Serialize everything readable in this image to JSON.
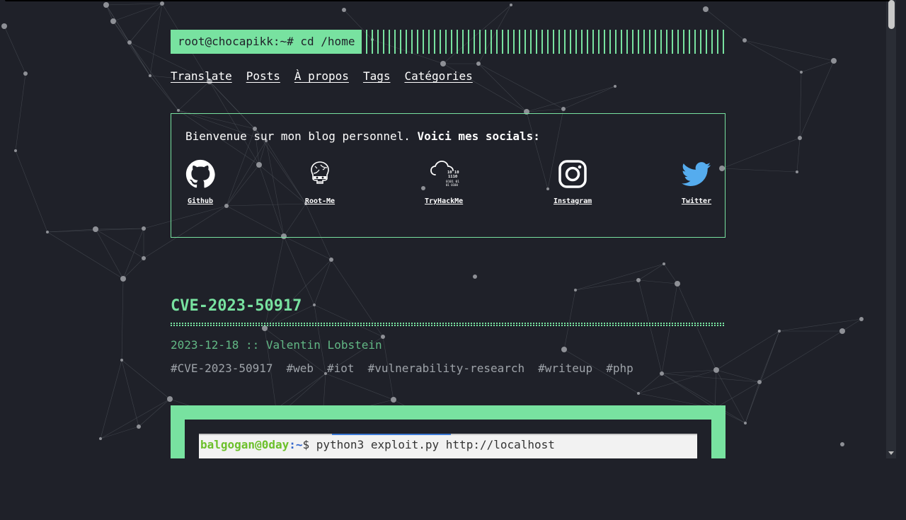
{
  "header": {
    "logo_text": "root@chocapikk:~# cd /home"
  },
  "menu": [
    {
      "label": "Translate"
    },
    {
      "label": "Posts"
    },
    {
      "label": "À propos"
    },
    {
      "label": "Tags"
    },
    {
      "label": "Catégories"
    }
  ],
  "welcome": {
    "text": "Bienvenue sur mon blog personnel.",
    "bold_text": "Voici mes socials:"
  },
  "socials": [
    {
      "label": "Github",
      "icon": "github-icon"
    },
    {
      "label": "Root-Me",
      "icon": "root-me-icon"
    },
    {
      "label": "TryHackMe",
      "icon": "tryhackme-icon"
    },
    {
      "label": "Instagram",
      "icon": "instagram-icon"
    },
    {
      "label": "Twitter",
      "icon": "twitter-icon"
    }
  ],
  "post": {
    "title": "CVE-2023-50917",
    "meta": "2023-12-18 :: Valentin Lobstein",
    "tags": [
      "#CVE-2023-50917",
      "#web",
      "#iot",
      "#vulnerability-research",
      "#writeup",
      "#php"
    ],
    "cover_terminal": {
      "user": "balgogan@0day",
      "path": ":~",
      "command": "$ python3 exploit.py http://localhost"
    }
  },
  "colors": {
    "accent": "#78e2a0",
    "background": "#1f2129",
    "tag_gray": "#9ea3a9",
    "twitter_blue": "#55acee"
  }
}
